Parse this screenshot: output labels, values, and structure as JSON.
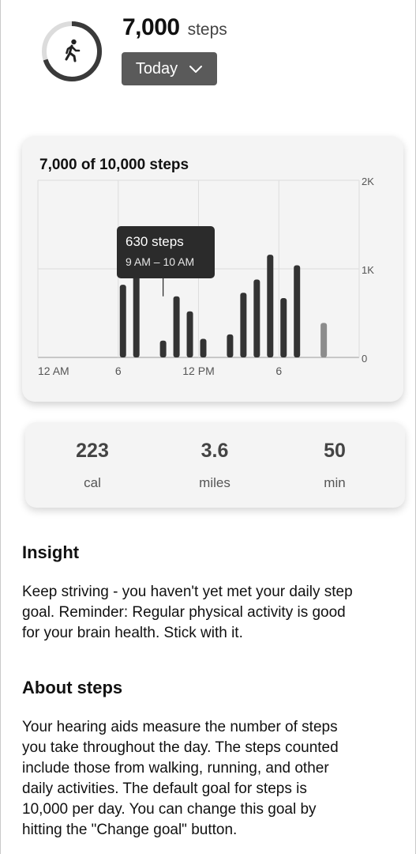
{
  "header": {
    "steps_value": "7,000",
    "steps_unit": "steps",
    "period_label": "Today",
    "icon": "walking-person-icon",
    "goal_progress": 0.7
  },
  "chart_data": {
    "type": "bar",
    "title": "7,000 of 10,000 steps",
    "x_tick_labels": [
      "12 AM",
      "6",
      "12 PM",
      "6"
    ],
    "y_tick_labels": [
      "2K",
      "1K",
      "0"
    ],
    "ylim": [
      0,
      2000
    ],
    "grid": true,
    "tooltip": {
      "value": "630 steps",
      "range": "9 AM – 10 AM"
    },
    "hours": [
      0,
      1,
      2,
      3,
      4,
      5,
      6,
      7,
      8,
      9,
      10,
      11,
      12,
      13,
      14,
      15,
      15.5,
      16,
      17,
      18,
      19,
      20,
      21,
      22,
      23
    ],
    "values": [
      0,
      0,
      0,
      0,
      0,
      0,
      820,
      1020,
      0,
      190,
      690,
      520,
      210,
      0,
      260,
      730,
      0,
      880,
      1160,
      670,
      1040,
      0,
      390,
      0,
      0
    ],
    "highlight_index": null,
    "muted_index": 22
  },
  "stats": [
    {
      "value": "223",
      "label": "cal"
    },
    {
      "value": "3.6",
      "label": "miles"
    },
    {
      "value": "50",
      "label": "min"
    }
  ],
  "insight": {
    "heading": "Insight",
    "line1": "Keep striving - you haven't yet met your daily step",
    "line2": "goal. Reminder: Regular physical activity is good",
    "line3": "for your brain health. Stick with it."
  },
  "about": {
    "heading": "About steps",
    "line1": "Your hearing aids measure the number of steps",
    "line2": "you take throughout the day. The steps counted",
    "line3": "include those from walking, running, and other",
    "line4": "daily activities. The default goal for steps is",
    "line5": "10,000 per day. You can change this goal by",
    "line6": "hitting the \"Change goal\" button."
  },
  "colors": {
    "bar": "#333333",
    "bar_muted": "#8c8c8c",
    "tooltip_bg": "#2b2b2b",
    "button_bg": "#5a5a5a"
  }
}
